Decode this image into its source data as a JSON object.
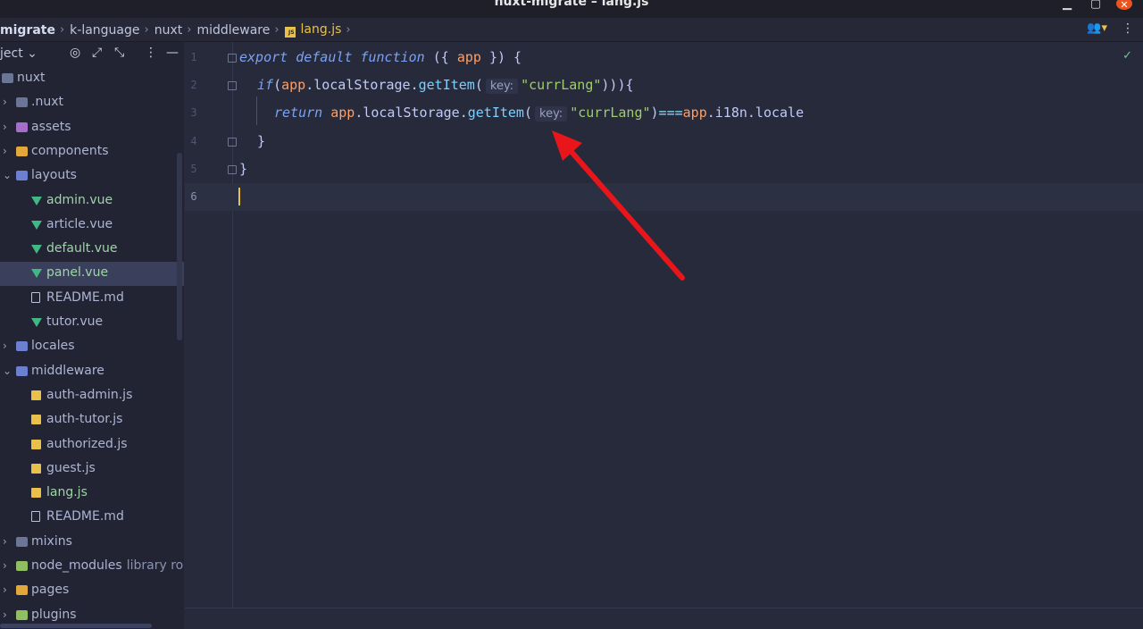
{
  "window": {
    "title": "nuxt-migrate – lang.js",
    "min_glyph": "▁",
    "max_glyph": "▢",
    "close_glyph": "✕"
  },
  "breadcrumb": [
    {
      "label": "migrate"
    },
    {
      "label": "k-language"
    },
    {
      "label": "nuxt"
    },
    {
      "label": "middleware"
    },
    {
      "label": "lang.js",
      "badge": "JS"
    }
  ],
  "breadcrumb_sep": "›",
  "nav_right": {
    "user_glyph": "👥▾",
    "more_glyph": "⋮"
  },
  "sidebar": {
    "header_label": "ject ⌄",
    "tools": {
      "target": "◎",
      "expand": "⤢",
      "collapse": "⤡",
      "more": "⋮",
      "hide": "—"
    },
    "items": [
      {
        "label": "nuxt",
        "icon": "folder",
        "depth": 0,
        "arrow": ""
      },
      {
        "label": ".nuxt",
        "icon": "folder",
        "depth": 0,
        "arrow": "›"
      },
      {
        "label": "assets",
        "icon": "folder-purple",
        "depth": 0,
        "arrow": "›"
      },
      {
        "label": "components",
        "icon": "folder-yellow",
        "depth": 0,
        "arrow": "›"
      },
      {
        "label": "layouts",
        "icon": "folder-blue",
        "depth": 0,
        "arrow": "⌄"
      },
      {
        "label": "admin.vue",
        "icon": "vue",
        "depth": 1,
        "arrow": "",
        "style": "mod"
      },
      {
        "label": "article.vue",
        "icon": "vue",
        "depth": 1,
        "arrow": ""
      },
      {
        "label": "default.vue",
        "icon": "vue",
        "depth": 1,
        "arrow": "",
        "style": "mod"
      },
      {
        "label": "panel.vue",
        "icon": "vue",
        "depth": 1,
        "arrow": "",
        "style": "mod",
        "selected": true
      },
      {
        "label": "README.md",
        "icon": "md",
        "depth": 1,
        "arrow": ""
      },
      {
        "label": "tutor.vue",
        "icon": "vue",
        "depth": 1,
        "arrow": ""
      },
      {
        "label": "locales",
        "icon": "folder-blue",
        "depth": 0,
        "arrow": "›"
      },
      {
        "label": "middleware",
        "icon": "folder-blue",
        "depth": 0,
        "arrow": "⌄"
      },
      {
        "label": "auth-admin.js",
        "icon": "js",
        "depth": 1,
        "arrow": ""
      },
      {
        "label": "auth-tutor.js",
        "icon": "js",
        "depth": 1,
        "arrow": ""
      },
      {
        "label": "authorized.js",
        "icon": "js",
        "depth": 1,
        "arrow": ""
      },
      {
        "label": "guest.js",
        "icon": "js",
        "depth": 1,
        "arrow": ""
      },
      {
        "label": "lang.js",
        "icon": "js",
        "depth": 1,
        "arrow": "",
        "style": "mod"
      },
      {
        "label": "README.md",
        "icon": "md",
        "depth": 1,
        "arrow": ""
      },
      {
        "label": "mixins",
        "icon": "folder",
        "depth": 0,
        "arrow": "›"
      },
      {
        "label": "node_modules",
        "icon": "folder-green",
        "depth": 0,
        "arrow": "›",
        "extra": "library roo"
      },
      {
        "label": "pages",
        "icon": "folder-yellow",
        "depth": 0,
        "arrow": "›"
      },
      {
        "label": "plugins",
        "icon": "folder-green",
        "depth": 0,
        "arrow": "›"
      }
    ]
  },
  "editor": {
    "check_glyph": "✓",
    "lines": [
      {
        "num": "1",
        "tokens": [
          [
            "kw",
            "export"
          ],
          [
            "t",
            " "
          ],
          [
            "kw",
            "default"
          ],
          [
            "t",
            " "
          ],
          [
            "kw",
            "function"
          ],
          [
            "t",
            " ({ "
          ],
          [
            "pa",
            "app"
          ],
          [
            "t",
            " }) {"
          ]
        ]
      },
      {
        "num": "2",
        "tokens": [
          [
            "kw",
            "if"
          ],
          [
            "t",
            "("
          ],
          [
            "pa",
            "app"
          ],
          [
            "t",
            ".localStorage."
          ],
          [
            "fn",
            "getItem"
          ],
          [
            "t",
            "("
          ],
          [
            "hint",
            "key:"
          ],
          [
            "str",
            "\"currLang\""
          ],
          [
            "t",
            "))){"
          ]
        ]
      },
      {
        "num": "3",
        "tokens": [
          [
            "kw",
            "return"
          ],
          [
            "t",
            " "
          ],
          [
            "pa",
            "app"
          ],
          [
            "t",
            ".localStorage."
          ],
          [
            "fn",
            "getItem"
          ],
          [
            "t",
            "("
          ],
          [
            "hint",
            "key:"
          ],
          [
            "str",
            "\"currLang\""
          ],
          [
            "t",
            ")"
          ],
          [
            "op",
            "==="
          ],
          [
            "pa",
            "app"
          ],
          [
            "t",
            ".i18n.locale"
          ]
        ]
      },
      {
        "num": "4",
        "tokens": [
          [
            "t",
            "}"
          ]
        ]
      },
      {
        "num": "5",
        "tokens": [
          [
            "t",
            "}"
          ]
        ]
      },
      {
        "num": "6",
        "tokens": []
      }
    ]
  }
}
